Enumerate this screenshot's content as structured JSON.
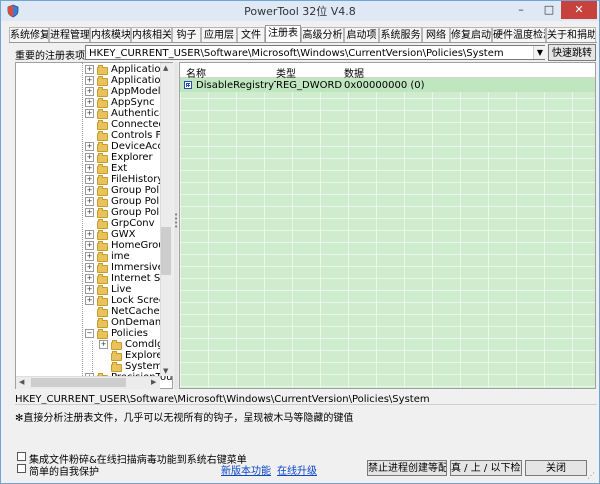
{
  "window": {
    "title": "PowerTool 32位 V4.8",
    "min_glyph": "–",
    "max_glyph": "□",
    "close_glyph": "✕"
  },
  "tabs": [
    "系统修复",
    "进程管理",
    "内核模块",
    "内核相关",
    "钩子",
    "应用层",
    "文件",
    "注册表",
    "高级分析",
    "启动项",
    "系统服务",
    "网络",
    "修复启动",
    "硬件温度检测",
    "关于和捐助"
  ],
  "active_tab": "注册表",
  "path_bar": {
    "label": "重要的注册表项：",
    "value": "HKEY_CURRENT_USER\\Software\\Microsoft\\Windows\\CurrentVersion\\Policies\\System",
    "go_label": "快速跳转"
  },
  "tree": {
    "items": [
      {
        "label": "ApplicationAs",
        "level": 1,
        "expander": "+"
      },
      {
        "label": "ApplicationVi",
        "level": 1,
        "expander": "+"
      },
      {
        "label": "AppModel",
        "level": 1,
        "expander": "+"
      },
      {
        "label": "AppSync",
        "level": 1,
        "expander": "+"
      },
      {
        "label": "Authenticatic",
        "level": 1,
        "expander": "+"
      },
      {
        "label": "ConnectedSe",
        "level": 1,
        "expander": ""
      },
      {
        "label": "Controls Fold",
        "level": 1,
        "expander": ""
      },
      {
        "label": "DeviceAccess",
        "level": 1,
        "expander": "+"
      },
      {
        "label": "Explorer",
        "level": 1,
        "expander": "+"
      },
      {
        "label": "Ext",
        "level": 1,
        "expander": "+"
      },
      {
        "label": "FileHistory",
        "level": 1,
        "expander": "+"
      },
      {
        "label": "Group Policy",
        "level": 1,
        "expander": "+"
      },
      {
        "label": "Group Policy",
        "level": 1,
        "expander": "+"
      },
      {
        "label": "Group Policy",
        "level": 1,
        "expander": "+"
      },
      {
        "label": "GrpConv",
        "level": 1,
        "expander": ""
      },
      {
        "label": "GWX",
        "level": 1,
        "expander": "+"
      },
      {
        "label": "HomeGroup",
        "level": 1,
        "expander": "+"
      },
      {
        "label": "ime",
        "level": 1,
        "expander": "+"
      },
      {
        "label": "ImmersiveSh",
        "level": 1,
        "expander": "+"
      },
      {
        "label": "Internet Set",
        "level": 1,
        "expander": "+"
      },
      {
        "label": "Live",
        "level": 1,
        "expander": "+"
      },
      {
        "label": "Lock Screen",
        "level": 1,
        "expander": "+"
      },
      {
        "label": "NetCache",
        "level": 1,
        "expander": ""
      },
      {
        "label": "OnDemandIn",
        "level": 1,
        "expander": ""
      },
      {
        "label": "Policies",
        "level": 1,
        "expander": "−"
      },
      {
        "label": "Comdlg32",
        "level": 2,
        "expander": "+"
      },
      {
        "label": "Explorer",
        "level": 2,
        "expander": ""
      },
      {
        "label": "System",
        "level": 2,
        "expander": ""
      },
      {
        "label": "PrecisionTou",
        "level": 1,
        "expander": "+"
      }
    ]
  },
  "list": {
    "columns": [
      "名称",
      "类型",
      "数据"
    ],
    "rows": [
      {
        "name": "DisableRegistryTo...",
        "type": "REG_DWORD",
        "data": "0x00000000 (0)"
      }
    ]
  },
  "status_path": "HKEY_CURRENT_USER\\Software\\Microsoft\\Windows\\CurrentVersion\\Policies\\System",
  "info_text": "✻直接分析注册表文件，几乎可以无视所有的钩子，呈现被木马等隐藏的键值",
  "options": {
    "integrate": "集成文件粉碎&在线扫描病毒功能到系统右键菜单",
    "self_protect": "简单的自我保护"
  },
  "links": {
    "new_features": "新版本功能",
    "online_update": "在线升级"
  },
  "buttons": {
    "block_keys": "禁止进程创建等配置",
    "detect": "真  /  上 / 以下检测",
    "close": "关闭"
  }
}
